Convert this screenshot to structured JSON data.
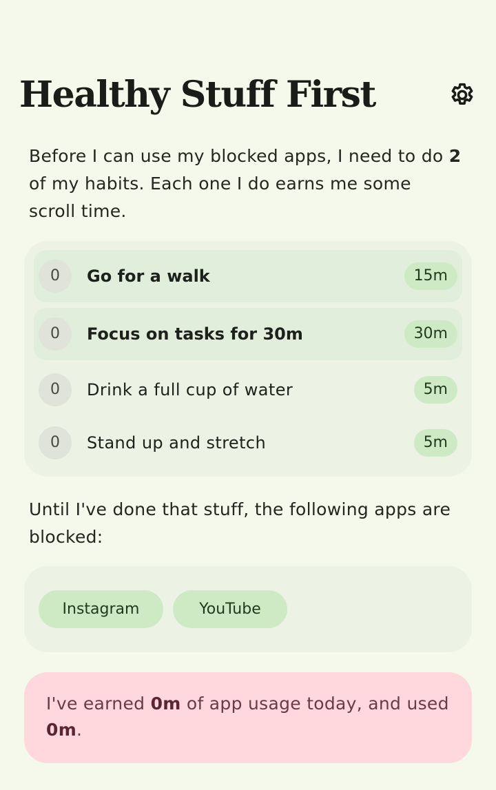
{
  "app": {
    "title": "Healthy Stuff First",
    "settings_icon": "gear-icon"
  },
  "intro": {
    "prefix": "Before I can use my blocked apps, I need to do",
    "required_count": "2",
    "suffix": "of my habits. Each one I do earns me some scroll time."
  },
  "habits": [
    {
      "count": "0",
      "name": "Go for a walk",
      "duration": "15m",
      "highlighted": true
    },
    {
      "count": "0",
      "name": "Focus on tasks for 30m",
      "duration": "30m",
      "highlighted": true
    },
    {
      "count": "0",
      "name": "Drink a full cup of water",
      "duration": "5m",
      "highlighted": false
    },
    {
      "count": "0",
      "name": "Stand up and stretch",
      "duration": "5m",
      "highlighted": false
    }
  ],
  "blocked": {
    "text": "Until I've done that stuff, the following apps are blocked:",
    "apps": [
      "Instagram",
      "YouTube"
    ]
  },
  "usage": {
    "prefix": "I've earned",
    "earned": "0m",
    "middle": "of app usage today, and used",
    "used": "0m",
    "end": "."
  },
  "colors": {
    "background": "#f5f9ec",
    "card": "#ecf2e4",
    "highlight_row": "#e1eedb",
    "chip": "#cdeac5",
    "usage_card": "#fed8dd"
  }
}
